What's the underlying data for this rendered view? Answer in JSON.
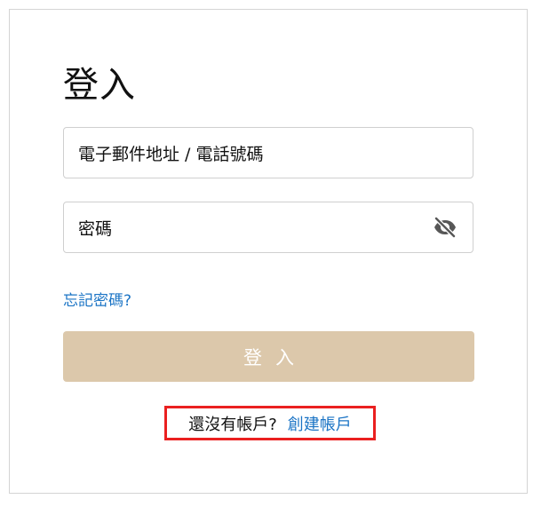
{
  "login": {
    "title": "登入",
    "email_placeholder": "電子郵件地址 / 電話號碼",
    "password_placeholder": "密碼",
    "password_visibility_icon": "eye-slash-icon",
    "forgot_password": "忘記密碼?",
    "submit_label": "登入",
    "no_account_text": "還沒有帳戶?",
    "create_account_link": "創建帳戶"
  },
  "colors": {
    "submit_button": "#dcc8ab",
    "link": "#1b74c5",
    "highlight_border": "#ea2020"
  }
}
